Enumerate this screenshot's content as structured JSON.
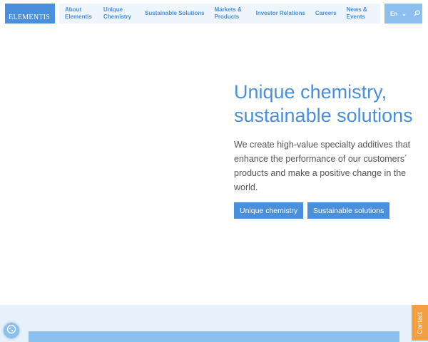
{
  "header": {
    "logo": "ELEMENTIS",
    "nav": [
      "About Elementis",
      "Unique Chemistry",
      "Sustainable Solutions",
      "Markets & Products",
      "Investor Relations",
      "Careers",
      "News & Events"
    ],
    "lang": "En"
  },
  "hero": {
    "title": "Unique chemistry, sustainable solutions",
    "description": "We create high-value specialty additives that enhance the performance of our customers´ products and make a positive change in the world.",
    "buttons": [
      "Unique chemistry",
      "Sustainable solutions"
    ]
  },
  "contact": "Contact"
}
